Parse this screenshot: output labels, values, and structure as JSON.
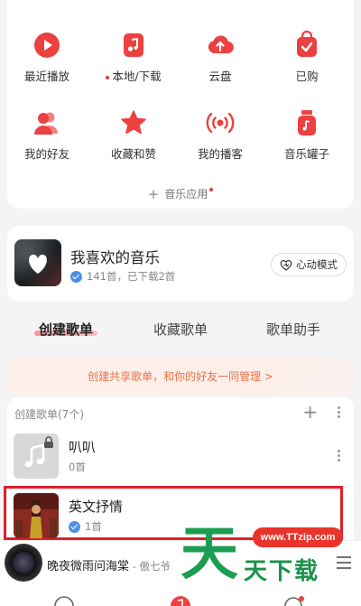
{
  "grid": {
    "items": [
      {
        "label": "最近播放",
        "icon": "play-circle-icon",
        "dot": false
      },
      {
        "label": "本地/下载",
        "icon": "music-file-icon",
        "dot": true
      },
      {
        "label": "云盘",
        "icon": "cloud-upload-icon",
        "dot": false
      },
      {
        "label": "已购",
        "icon": "purchased-bag-icon",
        "dot": false
      },
      {
        "label": "我的好友",
        "icon": "friends-icon",
        "dot": false
      },
      {
        "label": "收藏和赞",
        "icon": "star-icon",
        "dot": false
      },
      {
        "label": "我的播客",
        "icon": "broadcast-icon",
        "dot": false
      },
      {
        "label": "音乐罐子",
        "icon": "music-jar-icon",
        "dot": false
      }
    ],
    "music_app_label": "音乐应用"
  },
  "favorite": {
    "title": "我喜欢的音乐",
    "subtitle": "141首，已下载2首",
    "heart_mode_label": "心动模式"
  },
  "tabs": [
    {
      "label": "创建歌单",
      "active": true
    },
    {
      "label": "收藏歌单",
      "active": false
    },
    {
      "label": "歌单助手",
      "active": false
    }
  ],
  "banner": {
    "text": "创建共享歌单，和你的好友一同管理 >"
  },
  "playlists": {
    "header": "创建歌单(7个)",
    "items": [
      {
        "title": "叭叭",
        "subtitle": "0首",
        "locked": true,
        "highlighted": false
      },
      {
        "title": "英文抒情",
        "subtitle": "1首",
        "locked": false,
        "highlighted": true
      }
    ]
  },
  "player": {
    "title": "晚夜微雨问海棠",
    "artist": " - 傲七爷"
  },
  "watermark": {
    "url": "www.TTzip.com",
    "big": "天",
    "text": "天下载"
  },
  "colors": {
    "accent": "#e83b3b",
    "highlight_box": "#e01f2c",
    "banner_text": "#e8734a",
    "watermark_green": "#1b9e52"
  }
}
